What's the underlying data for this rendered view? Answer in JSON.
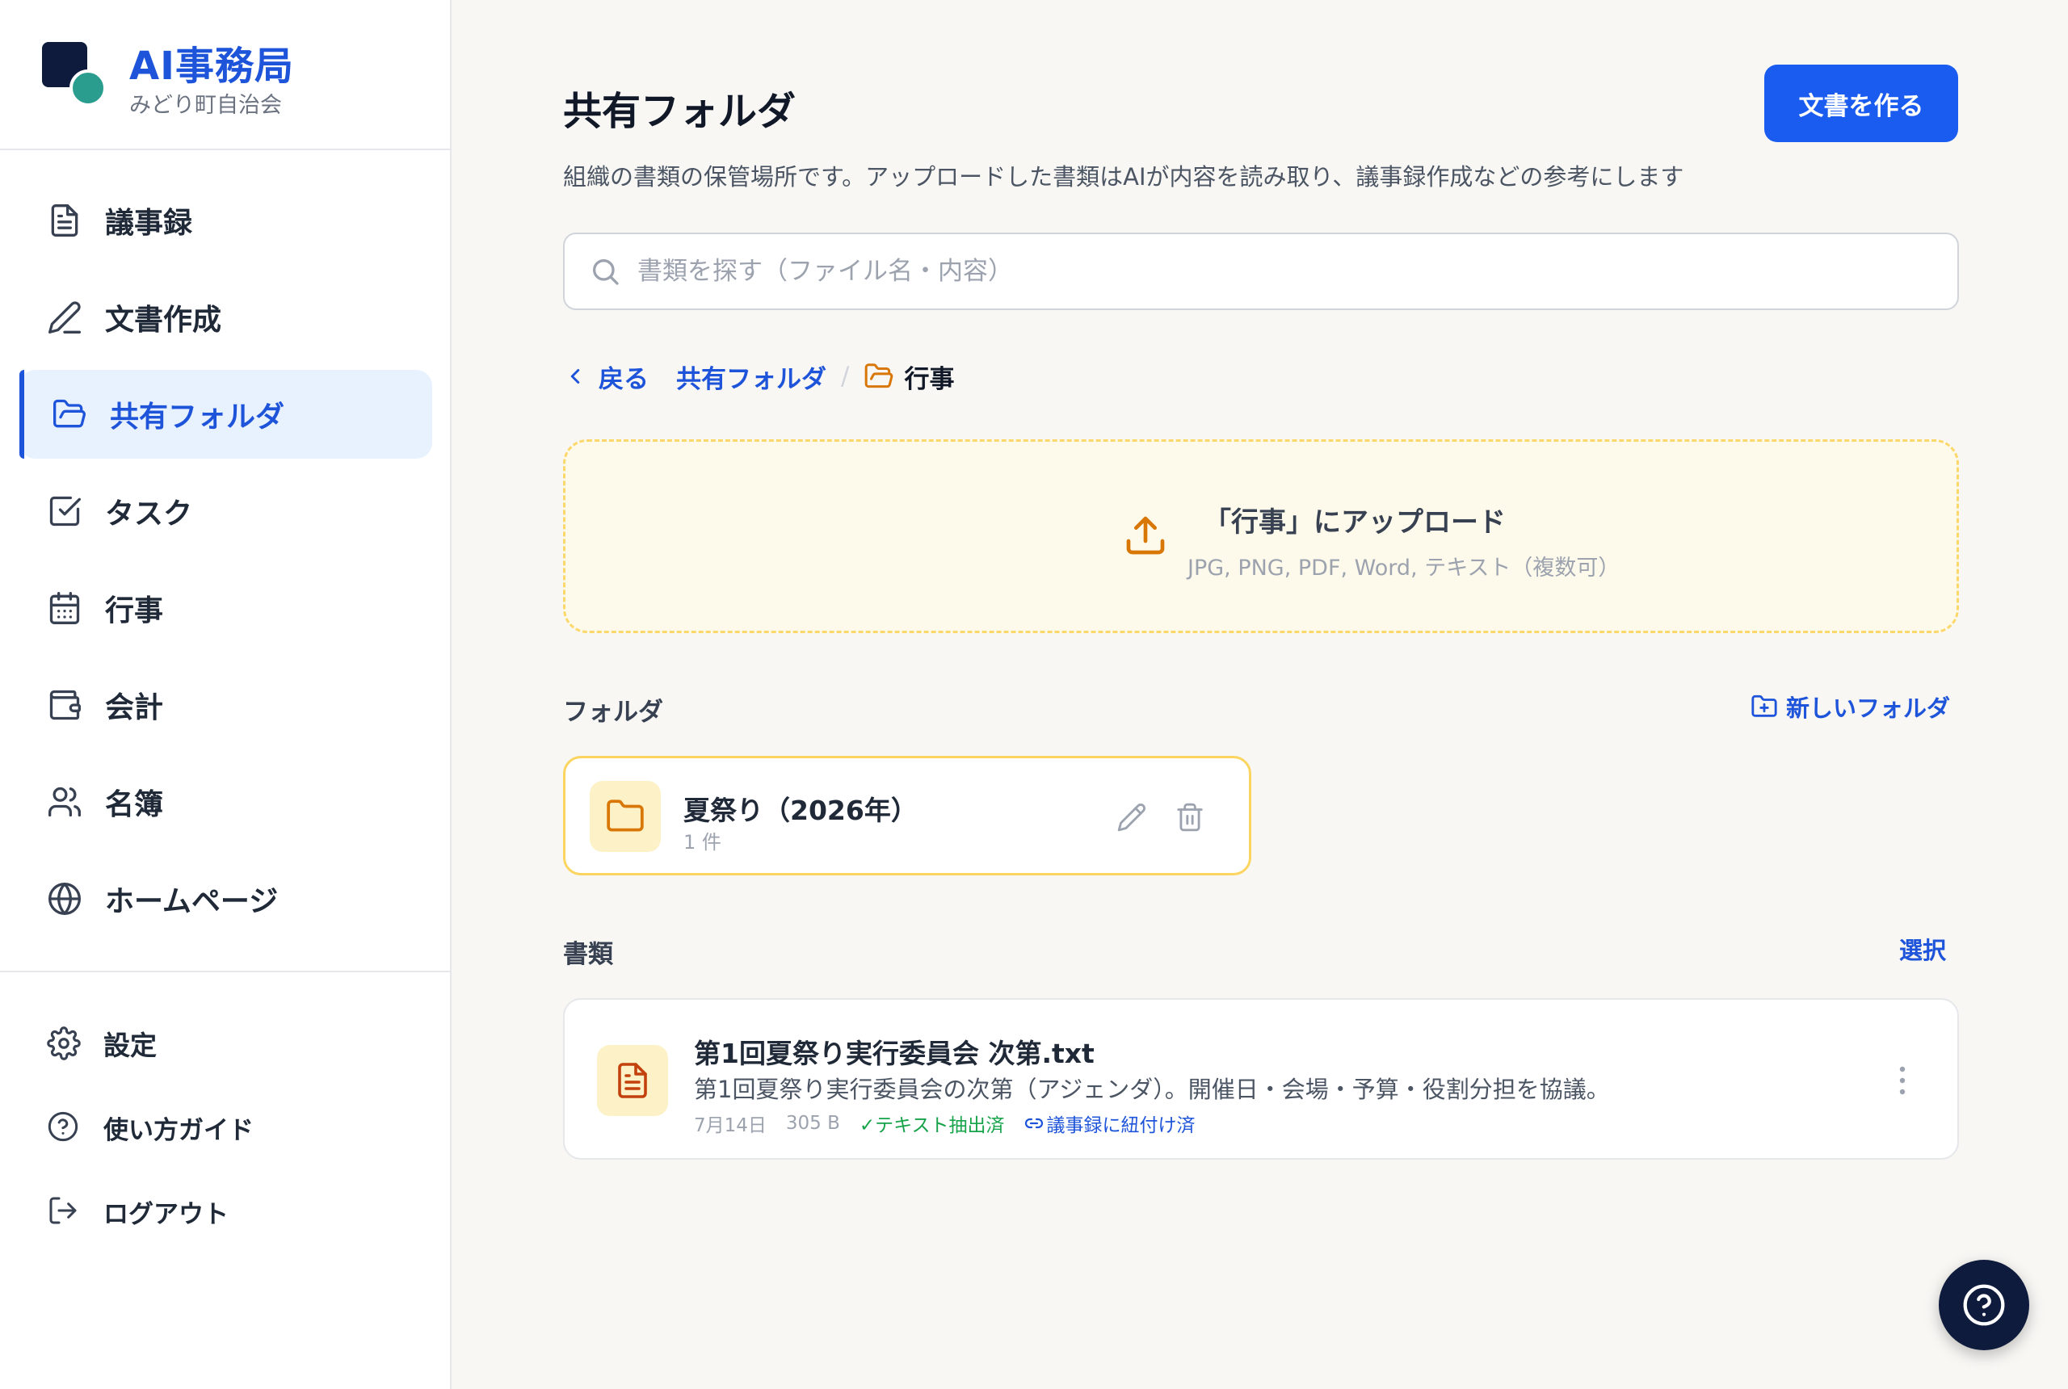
{
  "app": {
    "title": "AI事務局",
    "subtitle": "みどり町自治会"
  },
  "sidebar": {
    "items": [
      {
        "label": "議事録",
        "icon": "document-icon",
        "active": false
      },
      {
        "label": "文書作成",
        "icon": "pen-icon",
        "active": false
      },
      {
        "label": "共有フォルダ",
        "icon": "folder-open-icon",
        "active": true
      },
      {
        "label": "タスク",
        "icon": "checkbox-icon",
        "active": false
      },
      {
        "label": "行事",
        "icon": "calendar-icon",
        "active": false
      },
      {
        "label": "会計",
        "icon": "wallet-icon",
        "active": false
      },
      {
        "label": "名簿",
        "icon": "users-icon",
        "active": false
      },
      {
        "label": "ホームページ",
        "icon": "globe-icon",
        "active": false
      }
    ],
    "bottom": [
      {
        "label": "設定",
        "icon": "gear-icon"
      },
      {
        "label": "使い方ガイド",
        "icon": "help-circle-icon"
      },
      {
        "label": "ログアウト",
        "icon": "logout-icon"
      }
    ]
  },
  "header": {
    "title": "共有フォルダ",
    "description": "組織の書類の保管場所です。アップロードした書類はAIが内容を読み取り、議事録作成などの参考にします",
    "create_button": "文書を作る"
  },
  "search": {
    "placeholder": "書類を探す（ファイル名・内容）",
    "value": ""
  },
  "breadcrumb": {
    "back": "戻る",
    "root": "共有フォルダ",
    "separator": "/",
    "current": "行事"
  },
  "upload": {
    "title": "「行事」にアップロード",
    "hint": "JPG, PNG, PDF, Word, テキスト（複数可）"
  },
  "folders": {
    "label": "フォルダ",
    "new_folder": "新しいフォルダ",
    "items": [
      {
        "name": "夏祭り（2026年）",
        "count": "1 件"
      }
    ]
  },
  "documents": {
    "label": "書類",
    "select": "選択",
    "items": [
      {
        "name": "第1回夏祭り実行委員会 次第.txt",
        "description": "第1回夏祭り実行委員会の次第（アジェンダ）。開催日・会場・予算・役割分担を協議。",
        "date": "7月14日",
        "size": "305 B",
        "status_extracted": "✓テキスト抽出済",
        "status_linked": "議事録に紐付け済"
      }
    ]
  },
  "colors": {
    "accent": "#1a5cf0",
    "brand_navy": "#0f1b3d",
    "brand_teal": "#2a9d8f",
    "warning_bg": "#fefaeb",
    "folder_border": "#fbd560",
    "icon_orange": "#d97706",
    "success": "#16a34a"
  }
}
